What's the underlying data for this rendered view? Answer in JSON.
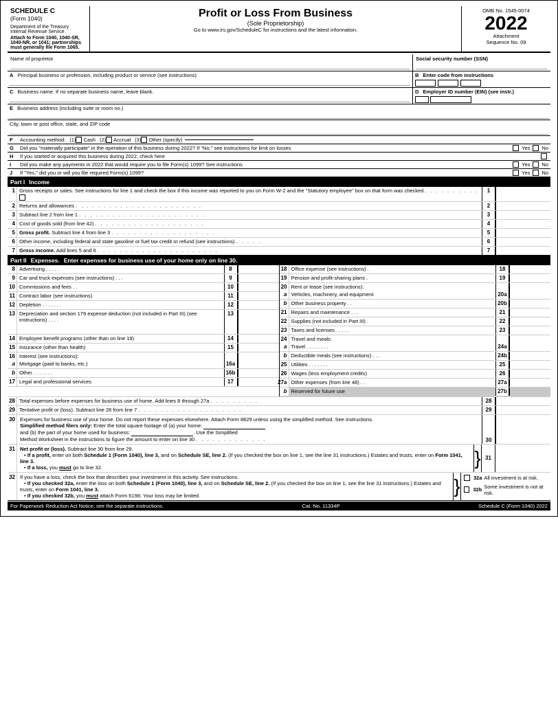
{
  "header": {
    "schedule_c": "SCHEDULE C",
    "form_1040": "(Form 1040)",
    "dept1": "Department of the Treasury",
    "dept2": "Internal Revenue Service",
    "main_title": "Profit or Loss From Business",
    "subtitle": "(Sole Proprietorship)",
    "instruction1": "Go to www.irs.gov/ScheduleC for instructions and the latest information.",
    "instruction2": "Attach to Form 1040, 1040-SR, 1040-NR, or 1041; partnerships must generally file Form 1065.",
    "omb": "OMB No. 1545-0074",
    "year": "2022",
    "attachment": "Attachment",
    "sequence": "Sequence No. 09"
  },
  "fields": {
    "name_label": "Name of proprietor",
    "ssn_label": "Social security number (SSN)",
    "a_label": "A",
    "a_text": "Principal business or profession, including product or service (see instructions)",
    "b_label": "B",
    "b_text": "Enter code from instructions",
    "c_label": "C",
    "c_text": "Business name. If no separate business name, leave blank.",
    "d_label": "D",
    "d_text": "Employer ID number (EIN) (see instr.)",
    "e_label": "E",
    "e_text": "Business address (including suite or room no.)",
    "e2_text": "City, town or post office, state, and ZIP code",
    "f_label": "F",
    "f_text": "Accounting method:",
    "f1": "(1)",
    "f1_check": "Cash",
    "f2": "(2)",
    "f2_check": "Accrual",
    "f3": "(3)",
    "f3_check": "Other (specify)",
    "g_label": "G",
    "g_text": "Did you \"materially participate\" in the operation of this business during 2022? If \"No,\" see instructions for limit on losses",
    "g_yes": "Yes",
    "g_no": "No",
    "h_label": "H",
    "h_text": "If you started or acquired this business during 2022, check here",
    "h_check": "",
    "i_label": "I",
    "i_text": "Did you make any payments in 2022 that would require you to file Form(s) 1099? See instructions",
    "i_yes": "Yes",
    "i_no": "No",
    "j_label": "J",
    "j_text": "If \"Yes,\" did you or will you file required Form(s) 1099?",
    "j_yes": "Yes",
    "j_no": "No"
  },
  "part1": {
    "label": "Part I",
    "title": "Income",
    "rows": [
      {
        "num": "1",
        "desc": "Gross receipts or sales. See instructions for line 1 and check the box if this income was reported to you on Form W-2 and the \"Statutory employee\" box on that form was checked",
        "line": "1"
      },
      {
        "num": "2",
        "desc": "Returns and allowances",
        "line": "2"
      },
      {
        "num": "3",
        "desc": "Subtract line 2 from line 1",
        "line": "3"
      },
      {
        "num": "4",
        "desc": "Cost of goods sold (from line 42)",
        "line": "4"
      },
      {
        "num": "5",
        "desc": "Gross profit. Subtract line 4 from line 3",
        "line": "5",
        "bold": true
      },
      {
        "num": "6",
        "desc": "Other income, including federal and state gasoline or fuel tax credit or refund (see instructions)",
        "line": "6"
      },
      {
        "num": "7",
        "desc": "Gross income. Add lines 5 and 6",
        "line": "7",
        "bold": true
      }
    ]
  },
  "part2": {
    "label": "Part II",
    "title_bold": "Expenses.",
    "title_rest": " Enter expenses for business use of your home only on line 30.",
    "left_rows": [
      {
        "num": "8",
        "desc": "Advertising . . . . .",
        "line": "8"
      },
      {
        "num": "9",
        "desc": "Car and truck expenses (see instructions) . . .",
        "line": "9"
      },
      {
        "num": "10",
        "desc": "Commissions and fees . .",
        "line": "10"
      },
      {
        "num": "11",
        "desc": "Contract labor (see instructions)",
        "line": "11"
      },
      {
        "num": "12",
        "desc": "Depletion . . . . . . .",
        "line": "12"
      },
      {
        "num": "13",
        "desc": "Depreciation and section 179 expense deduction (not included in Part III) (see instructions) . . . .",
        "line": "13"
      },
      {
        "num": "14",
        "desc": "Employee benefit programs (other than on line 19)",
        "line": "14"
      },
      {
        "num": "15",
        "desc": "Insurance (other than health)",
        "line": "15"
      },
      {
        "num": "16",
        "desc": "Interest (see instructions):",
        "line": ""
      },
      {
        "num": "a",
        "desc": "Mortgage (paid to banks, etc.)",
        "line": "16a",
        "sub": true
      },
      {
        "num": "b",
        "desc": "Other . . . . . . .",
        "line": "16b",
        "sub": true
      },
      {
        "num": "17",
        "desc": "Legal and professional services",
        "line": "17"
      }
    ],
    "right_rows": [
      {
        "num": "18",
        "desc": "Office expense (see instructions) .",
        "line": "18"
      },
      {
        "num": "19",
        "desc": "Pension and profit-sharing plans .",
        "line": "19"
      },
      {
        "num": "20",
        "desc": "Rent or lease (see instructions):",
        "line": "",
        "sub_rows": [
          {
            "letter": "a",
            "desc": "Vehicles, machinery, and equipment",
            "line": "20a"
          },
          {
            "letter": "b",
            "desc": "Other business property . .",
            "line": "20b"
          }
        ]
      },
      {
        "num": "21",
        "desc": "Repairs and maintenance . . .",
        "line": "21"
      },
      {
        "num": "22",
        "desc": "Supplies (not included in Part III) .",
        "line": "22"
      },
      {
        "num": "23",
        "desc": "Taxes and licenses . . . . .",
        "line": "23"
      },
      {
        "num": "24",
        "desc": "Travel and meals:",
        "line": "",
        "sub_rows": [
          {
            "letter": "a",
            "desc": "Travel . . . . . . . .",
            "line": "24a"
          },
          {
            "letter": "b",
            "desc": "Deductible meals (see instructions) . . .",
            "line": "24b"
          }
        ]
      },
      {
        "num": "25",
        "desc": "Utilities . . . . . . .",
        "line": "25"
      },
      {
        "num": "26",
        "desc": "Wages (less employment credits)",
        "line": "26"
      },
      {
        "num": "27a",
        "desc": "Other expenses (from line 48) . .",
        "line": "27a"
      },
      {
        "num": "b",
        "desc": "Reserved for future use",
        "line": "27b",
        "gray": true
      }
    ]
  },
  "bottom_rows": [
    {
      "num": "28",
      "desc": "Total expenses before expenses for business use of home. Add lines 8 through 27a . . . . . . . . .",
      "line": "28"
    },
    {
      "num": "29",
      "desc": "Tentative profit or (loss). Subtract line 28 from line 7 . . . . . . . . . . . . . . . . . . . .",
      "line": "29"
    }
  ],
  "line30": {
    "desc1": "Expenses for business use of your home. Do not report these expenses elsewhere. Attach Form 8829 unless using the simplified method. See instructions.",
    "desc2_bold": "Simplified method filers only:",
    "desc2_rest": " Enter the total square footage of (a) your home:",
    "desc3": "and (b) the part of your home used for business:",
    "desc3_end": ". Use the Simplified",
    "desc4": "Method Worksheet in the instructions to figure the amount to enter on line 30",
    "line": "30"
  },
  "line31": {
    "num": "31",
    "desc": "Net profit or (loss). Subtract line 30 from line 29.",
    "bullet1_bold": "If a profit,",
    "bullet1_rest": " enter on both Schedule 1 (Form 1040), line 3, and on Schedule SE, line 2. (If you checked the box on line 1, see the line 31 instructions.) Estates and trusts, enter on Form 1041, line 3.",
    "bullet2_bold": "If a loss,",
    "bullet2_rest": " you must go to line 32.",
    "line": "31"
  },
  "line32": {
    "num": "32",
    "desc": "If you have a loss, check the box that describes your investment in this activity. See instructions.",
    "bullet1_bold": "If you checked 32a,",
    "bullet1_rest": " enter the loss on both Schedule 1 (Form 1040), line 3, and on Schedule SE, line 2. (If you checked the box on line 1, see the line 31 instructions.) Estates and trusts, enter on Form 1041, line 3.",
    "bullet2_bold": "If you checked 32b,",
    "bullet2_rest": " you must attach Form 6198. Your loss may be limited.",
    "check_32a_label": "32a",
    "check_32a_text": "All investment is at risk.",
    "check_32b_label": "32b",
    "check_32b_text": "Some investment is not at risk."
  },
  "footer": {
    "left": "For Paperwork Reduction Act Notice, see the separate instructions.",
    "cat": "Cat. No. 11334P",
    "right": "Schedule C (Form 1040) 2022"
  }
}
